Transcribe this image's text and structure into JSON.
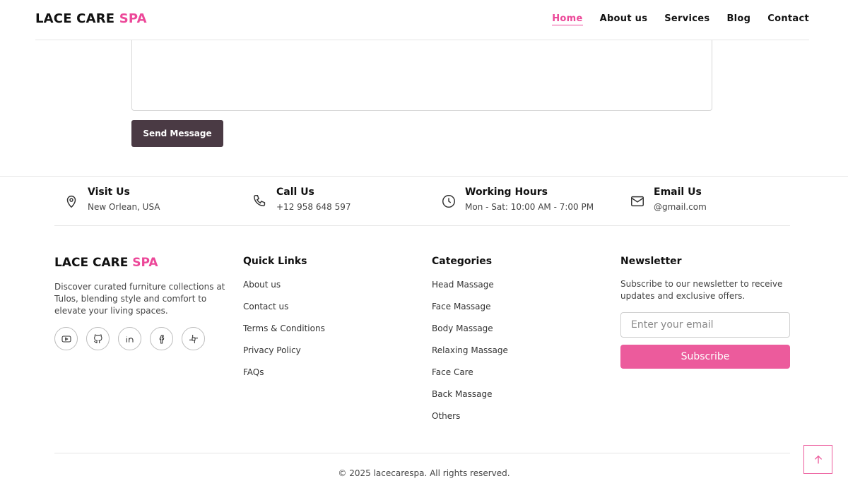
{
  "header": {
    "brand_main": "LACE CARE",
    "brand_accent": "SPA",
    "nav": [
      "Home",
      "About us",
      "Services",
      "Blog",
      "Contact"
    ],
    "active_nav": "Home"
  },
  "form": {
    "send_label": "Send Message"
  },
  "info": [
    {
      "title": "Visit Us",
      "value": "New Orlean, USA",
      "icon": "location-pin-icon"
    },
    {
      "title": "Call Us",
      "value": "+12 958 648 597",
      "icon": "phone-icon"
    },
    {
      "title": "Working Hours",
      "value": "Mon - Sat: 10:00 AM - 7:00 PM",
      "icon": "clock-icon"
    },
    {
      "title": "Email Us",
      "value": "@gmail.com",
      "icon": "mail-icon"
    }
  ],
  "footer": {
    "brand_main": "LACE CARE",
    "brand_accent": "SPA",
    "description": "Discover curated furniture collections at Tulos, blending style and comfort to elevate your living spaces.",
    "socials": [
      "youtube-icon",
      "github-icon",
      "linkedin-icon",
      "facebook-icon",
      "slack-icon"
    ],
    "quick_links_title": "Quick Links",
    "quick_links": [
      "About us",
      "Contact us",
      "Terms & Conditions",
      "Privacy Policy",
      "FAQs"
    ],
    "categories_title": "Categories",
    "categories": [
      "Head Massage",
      "Face Massage",
      "Body Massage",
      "Relaxing Massage",
      "Face Care",
      "Back Massage",
      "Others"
    ],
    "newsletter_title": "Newsletter",
    "newsletter_text": "Subscribe to our newsletter to receive updates and exclusive offers.",
    "email_placeholder": "Enter your email",
    "subscribe_label": "Subscribe",
    "copyright": "© 2025 lacecarespa. All rights reserved."
  },
  "colors": {
    "accent": "#ec4899",
    "button_dark": "#4a3a44",
    "subscribe": "#ec5b9c"
  }
}
